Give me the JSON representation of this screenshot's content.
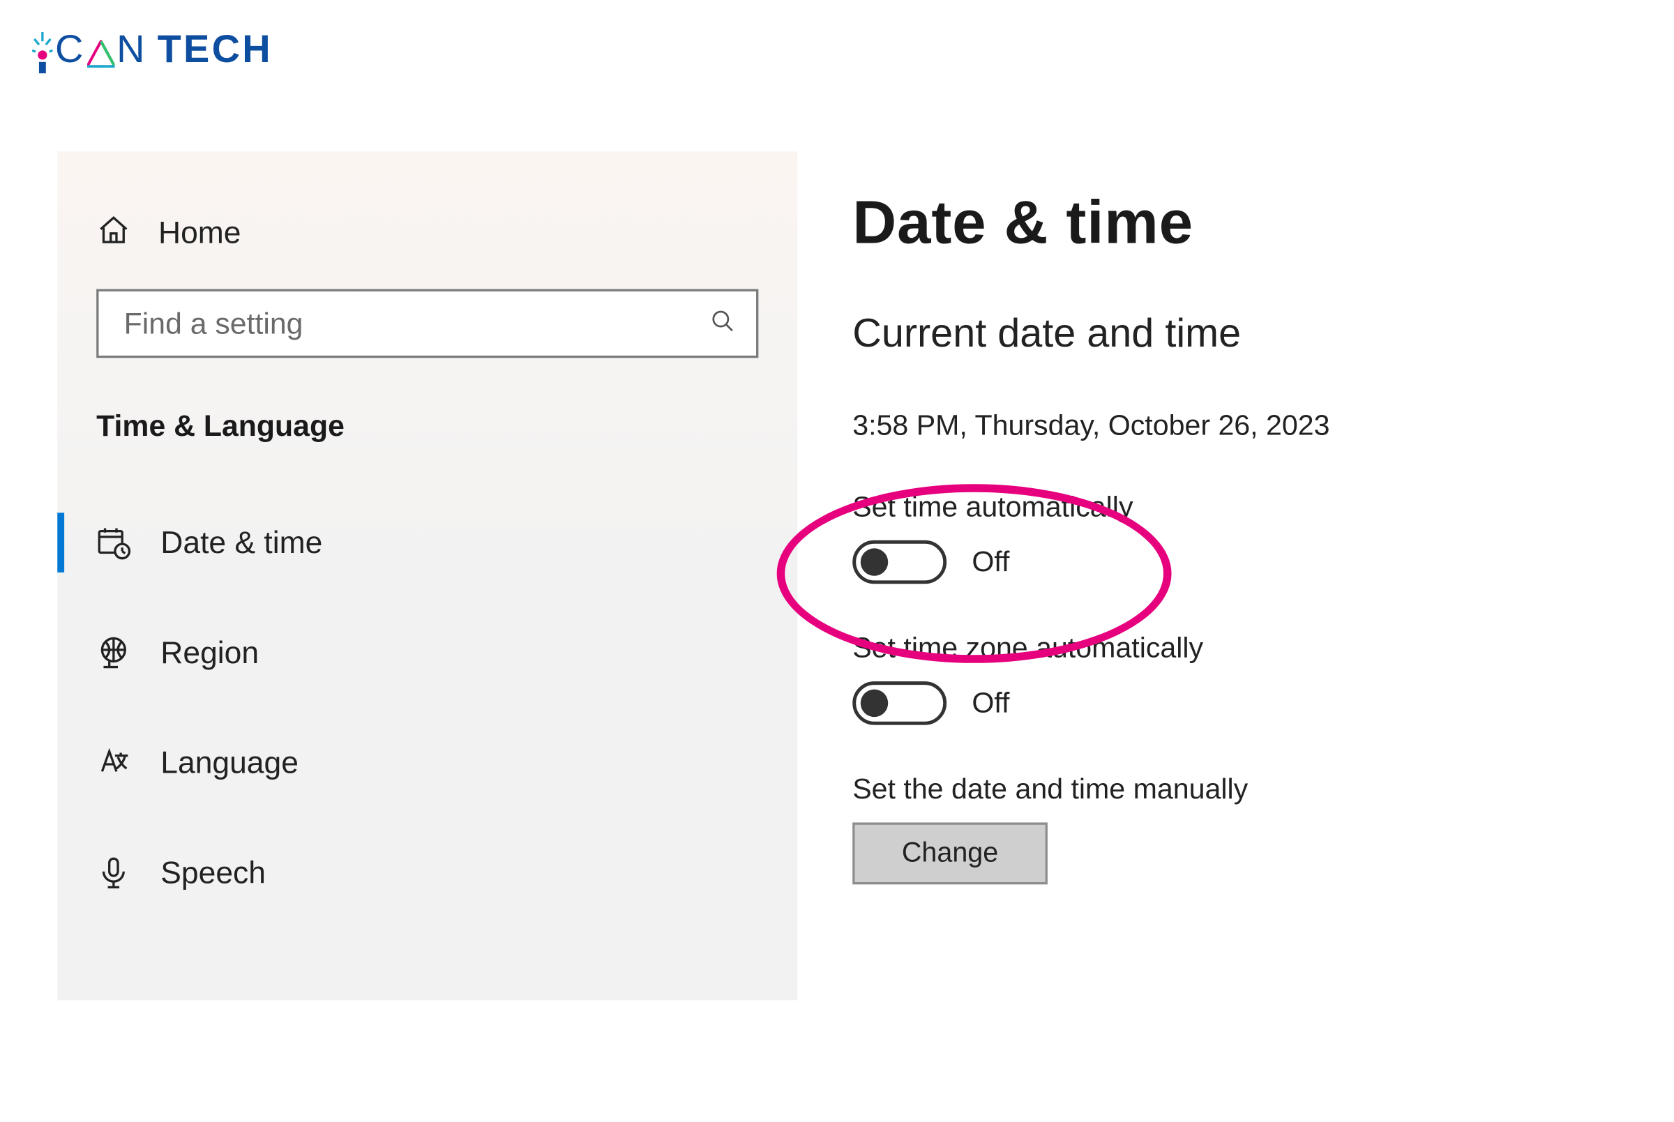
{
  "logo": {
    "part1_letter": "C",
    "part1_letter2": "N",
    "tech": "TECH"
  },
  "sidebar": {
    "home_label": "Home",
    "search_placeholder": "Find a setting",
    "category_title": "Time & Language",
    "items": [
      {
        "label": "Date & time"
      },
      {
        "label": "Region"
      },
      {
        "label": "Language"
      },
      {
        "label": "Speech"
      }
    ]
  },
  "main": {
    "title": "Date & time",
    "section_title": "Current date and time",
    "current_datetime": "3:58 PM, Thursday, October 26, 2023",
    "set_time_auto": {
      "label": "Set time automatically",
      "state": "Off"
    },
    "set_tz_auto": {
      "label": "Set time zone automatically",
      "state": "Off"
    },
    "set_manual": {
      "label": "Set the date and time manually",
      "button": "Change"
    }
  },
  "annotation": {
    "highlight": "set-time-automatically"
  }
}
